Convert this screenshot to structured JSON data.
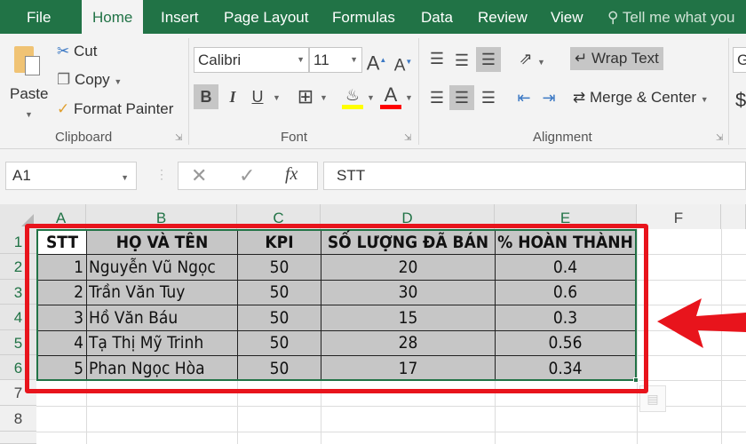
{
  "ribbon_tabs": [
    "File",
    "Home",
    "Insert",
    "Page Layout",
    "Formulas",
    "Data",
    "Review",
    "View"
  ],
  "tell_me": "Tell me what you",
  "clipboard": {
    "paste": "Paste",
    "cut": "Cut",
    "copy": "Copy",
    "format_painter": "Format Painter",
    "label": "Clipboard"
  },
  "font": {
    "name": "Calibri",
    "size": "11",
    "label": "Font",
    "bold": "B",
    "italic": "I",
    "underline": "U",
    "fill_color": "#ffff00",
    "font_color": "#ff0000"
  },
  "alignment": {
    "wrap_text": "Wrap Text",
    "merge_center": "Merge & Center",
    "label": "Alignment"
  },
  "number_partial": {
    "format": "G",
    "currency": "$"
  },
  "name_box": "A1",
  "formula": "STT",
  "fx_label": "fx",
  "columns": [
    "A",
    "B",
    "C",
    "D",
    "E",
    "F"
  ],
  "rows": [
    "1",
    "2",
    "3",
    "4",
    "5",
    "6",
    "7",
    "8"
  ],
  "table": {
    "headers": [
      "STT",
      "HỌ VÀ TÊN",
      "KPI",
      "SỐ LƯỢNG ĐÃ BÁN",
      "% HOÀN THÀNH"
    ],
    "rows": [
      [
        "1",
        "Nguyễn Vũ Ngọc",
        "50",
        "20",
        "0.4"
      ],
      [
        "2",
        "Trần Văn Tuy",
        "50",
        "30",
        "0.6"
      ],
      [
        "3",
        "Hồ Văn Báu",
        "50",
        "15",
        "0.3"
      ],
      [
        "4",
        "Tạ Thị Mỹ Trinh",
        "50",
        "28",
        "0.56"
      ],
      [
        "5",
        "Phan Ngọc Hòa",
        "50",
        "17",
        "0.34"
      ]
    ]
  },
  "colors": {
    "excel_green": "#217346",
    "selection_fill": "#c6c6c6",
    "annotation_red": "#e8141c"
  }
}
